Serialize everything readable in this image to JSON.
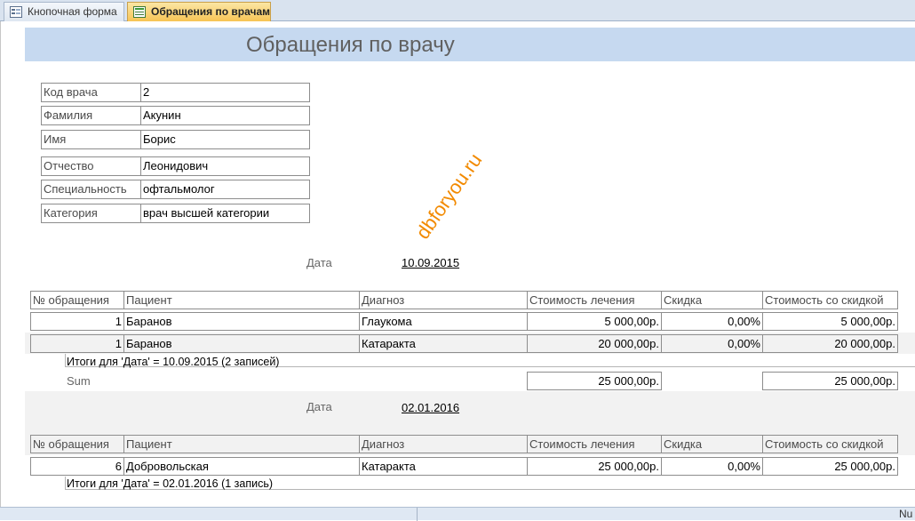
{
  "tabs": [
    {
      "label": "Кнопочная форма",
      "icon": "form-icon",
      "active": false
    },
    {
      "label": "Обращения по врачам",
      "icon": "report-icon",
      "active": true
    }
  ],
  "report": {
    "title": "Обращения по врачу",
    "doctor_fields": [
      {
        "label": "Код врача",
        "value": "2"
      },
      {
        "label": "Фамилия",
        "value": "Акунин"
      },
      {
        "label": "Имя",
        "value": "Борис"
      },
      {
        "label": "Отчество",
        "value": "Леонидович"
      },
      {
        "label": "Специальность",
        "value": "офтальмолог"
      },
      {
        "label": "Категория",
        "value": "врач высшей категории"
      }
    ],
    "watermark": "dbforyou.ru",
    "columns": [
      "№ обращения",
      "Пациент",
      "Диагноз",
      "Стоимость лечения",
      "Скидка",
      "Стоимость со скидкой"
    ],
    "groups": [
      {
        "date_label": "Дата",
        "date": "10.09.2015",
        "rows": [
          {
            "num": "1",
            "patient": "Баранов",
            "diagnosis": "Глаукома",
            "cost": "5 000,00р.",
            "discount": "0,00%",
            "discounted": "5 000,00р."
          },
          {
            "num": "1",
            "patient": "Баранов",
            "diagnosis": "Катаракта",
            "cost": "20 000,00р.",
            "discount": "0,00%",
            "discounted": "20 000,00р."
          }
        ],
        "summary": "Итоги для 'Дата' =  10.09.2015 (2 записей)",
        "sum_label": "Sum",
        "sum_cost": "25 000,00р.",
        "sum_discounted": "25 000,00р."
      },
      {
        "date_label": "Дата",
        "date": "02.01.2016",
        "rows": [
          {
            "num": "6",
            "patient": "Добровольская",
            "diagnosis": "Катаракта",
            "cost": "25 000,00р.",
            "discount": "0,00%",
            "discounted": "25 000,00р."
          }
        ],
        "summary": "Итоги для 'Дата' =  02.01.2016 (1 запись)"
      }
    ]
  },
  "status": {
    "right_text": "Nu"
  }
}
